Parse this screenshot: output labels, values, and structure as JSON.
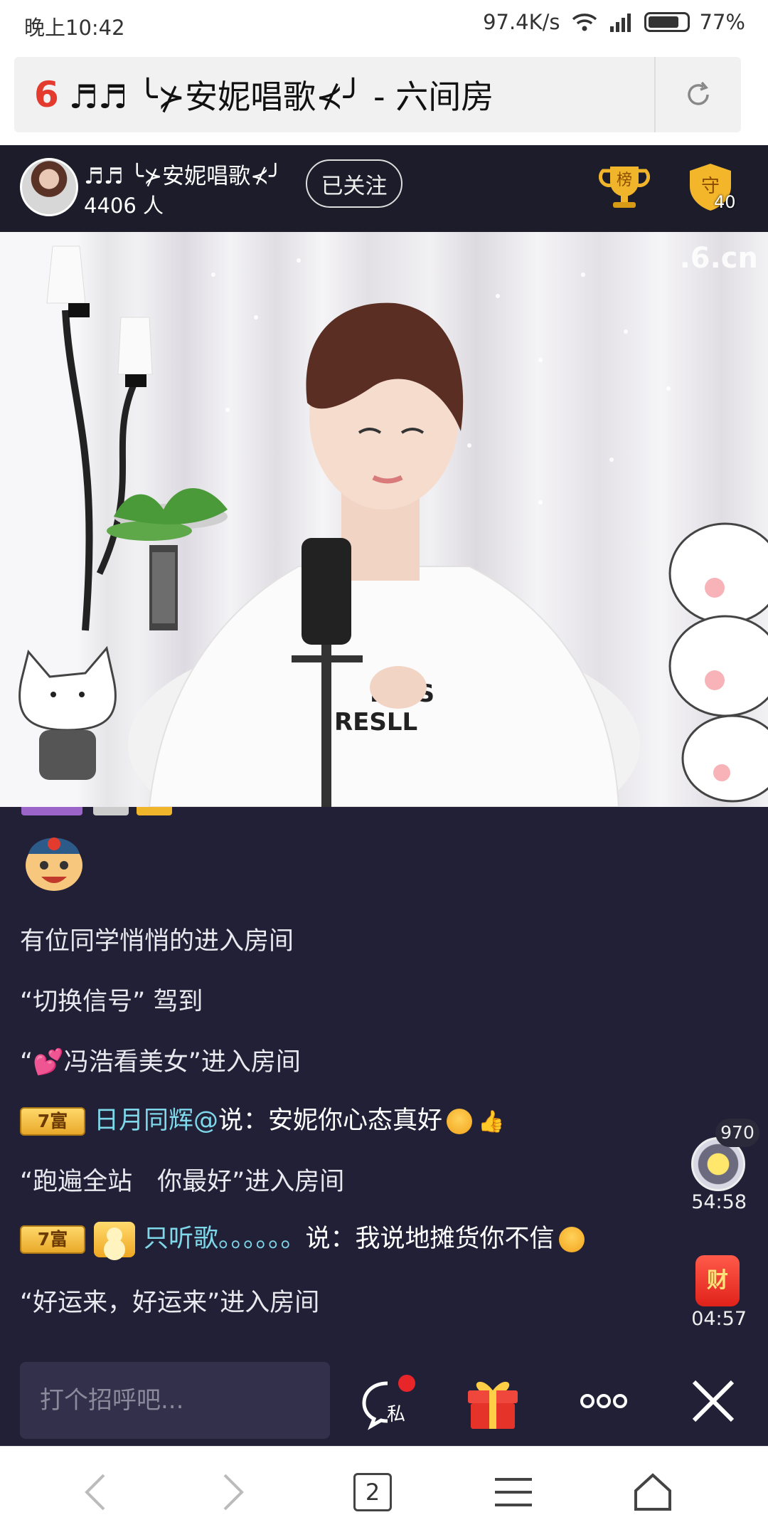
{
  "status_bar": {
    "time": "晚上10:42",
    "network_speed": "97.4K/s",
    "battery": "77%"
  },
  "address_bar": {
    "title": "♬♬ ╰⊁安妮唱歌⊀╯ - 六间房"
  },
  "room": {
    "host_name": "♬♬ ╰⊁安妮唱歌⊀╯",
    "viewers": "4406 人",
    "follow_label": "已关注",
    "rank_badge": "榜",
    "guard_badge": "守",
    "guard_count": "40",
    "watermark": ".6.cn"
  },
  "chat": {
    "messages": [
      {
        "text": "有位同学悄悄的进入房间"
      },
      {
        "text": "“切换信号” 驾到"
      },
      {
        "pre": "“",
        "emoji": "💕",
        "text": "冯浩看美女”进入房间"
      },
      {
        "level": "7富",
        "nick": "日月同辉@",
        "text": "说：安妮你心态真好"
      },
      {
        "text": "“跑遍全站　你最好”进入房间"
      },
      {
        "level": "7富",
        "nick": "只听歌。。。。。。",
        "text": "说：我说地摊货你不信"
      },
      {
        "text": "“好运来，好运来”进入房间"
      }
    ]
  },
  "side": {
    "star_count": "970",
    "star_timer": "54:58",
    "packet_label": "财",
    "packet_timer": "04:57"
  },
  "input_bar": {
    "placeholder": "打个招呼吧...",
    "private_label": "私"
  },
  "browser_nav": {
    "tab_count": "2"
  },
  "colors": {
    "chat_bg": "#222036",
    "nick": "#7fd7ea",
    "brand_red": "#e33b2e"
  }
}
